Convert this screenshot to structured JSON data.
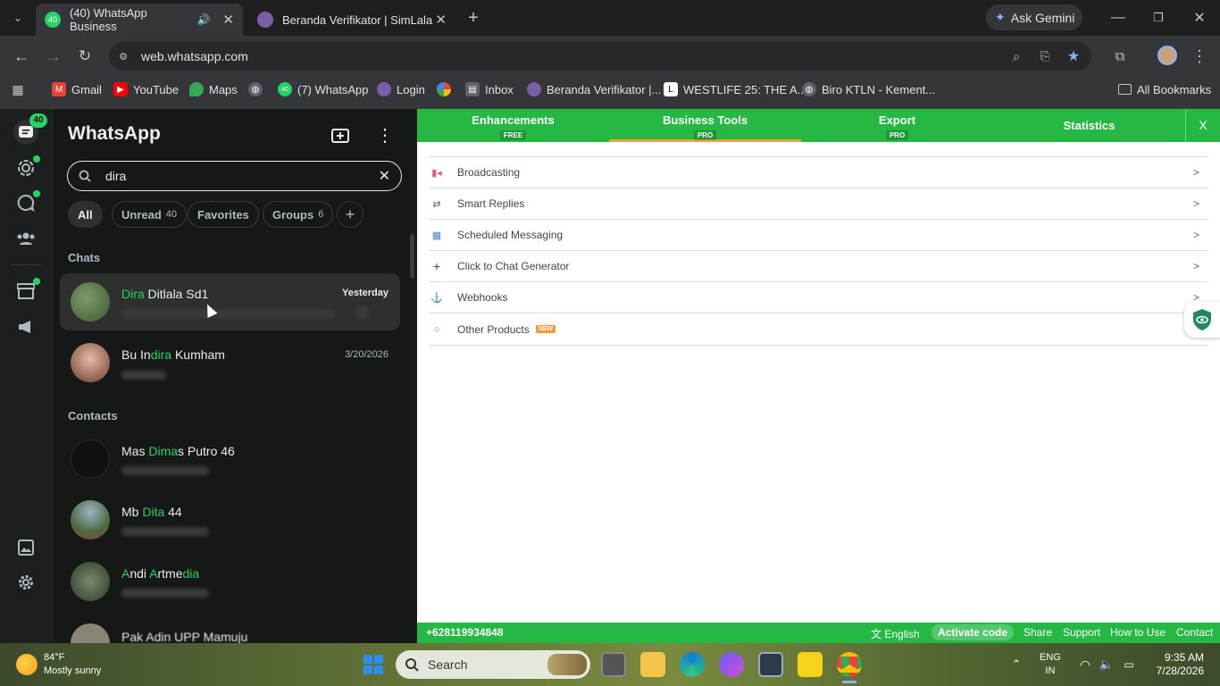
{
  "browser": {
    "tabs": [
      {
        "title": "(40) WhatsApp Business",
        "badge": "40"
      },
      {
        "title": "Beranda Verifikator | SimLala"
      }
    ],
    "ask_gemini": "Ask Gemini",
    "url": "web.whatsapp.com",
    "bookmarks": [
      "Gmail",
      "YouTube",
      "Maps",
      "(7) WhatsApp",
      "Login",
      "Inbox",
      "Beranda Verifikator |...",
      "WESTLIFE 25: THE A...",
      "Biro KTLN - Kement..."
    ],
    "all_bookmarks": "All Bookmarks",
    "whatsapp_bm_badge": "40"
  },
  "whatsapp": {
    "rail_badge": "40",
    "title": "WhatsApp",
    "search_value": "dira",
    "filters": [
      {
        "label": "All"
      },
      {
        "label": "Unread",
        "count": "40"
      },
      {
        "label": "Favorites"
      },
      {
        "label": "Groups",
        "count": "6"
      }
    ],
    "chats_header": "Chats",
    "contacts_header": "Contacts",
    "chats": [
      {
        "name_hl": "Dira",
        "name_rest": " Ditlala Sd1",
        "time": "Yesterday"
      },
      {
        "name_pre": "Bu In",
        "name_hl": "dira",
        "name_rest": " Kumham",
        "time": "3/20/2026"
      }
    ],
    "contacts": [
      {
        "pre": "Mas ",
        "hl": "Dima",
        "rest": "s Putro 46"
      },
      {
        "pre": "Mb ",
        "hl": "Dita",
        "rest": " 44"
      },
      {
        "hl1": "A",
        "mid1": "ndi ",
        "hl2": "A",
        "mid2": "rtme",
        "hl3": "dia"
      },
      {
        "text": "Pak Adin UPP Mamuju"
      }
    ]
  },
  "extension": {
    "tabs": [
      {
        "label": "Enhancements",
        "badge": "FREE"
      },
      {
        "label": "Business Tools",
        "badge": "PRO"
      },
      {
        "label": "Export",
        "badge": "PRO"
      },
      {
        "label": "Statistics"
      }
    ],
    "close": "X",
    "items": [
      {
        "label": "Broadcasting",
        "arrow": ">"
      },
      {
        "label": "Smart Replies",
        "arrow": ">"
      },
      {
        "label": "Scheduled Messaging",
        "arrow": ">"
      },
      {
        "label": "Click to Chat Generator",
        "arrow": ">"
      },
      {
        "label": "Webhooks",
        "arrow": ">"
      },
      {
        "label": "Other Products",
        "badge": "NEW"
      }
    ],
    "footer": {
      "phone": "+628119934848",
      "language": "English",
      "activate": "Activate code",
      "share": "Share",
      "support": "Support",
      "how_to_use": "How to Use",
      "contact": "Contact"
    },
    "accent": "#25b943"
  },
  "taskbar": {
    "weather_temp": "84°F",
    "weather_desc": "Mostly sunny",
    "search": "Search",
    "lang": "ENG",
    "region": "IN",
    "time": "9:35 AM",
    "date": "7/28/2026"
  }
}
